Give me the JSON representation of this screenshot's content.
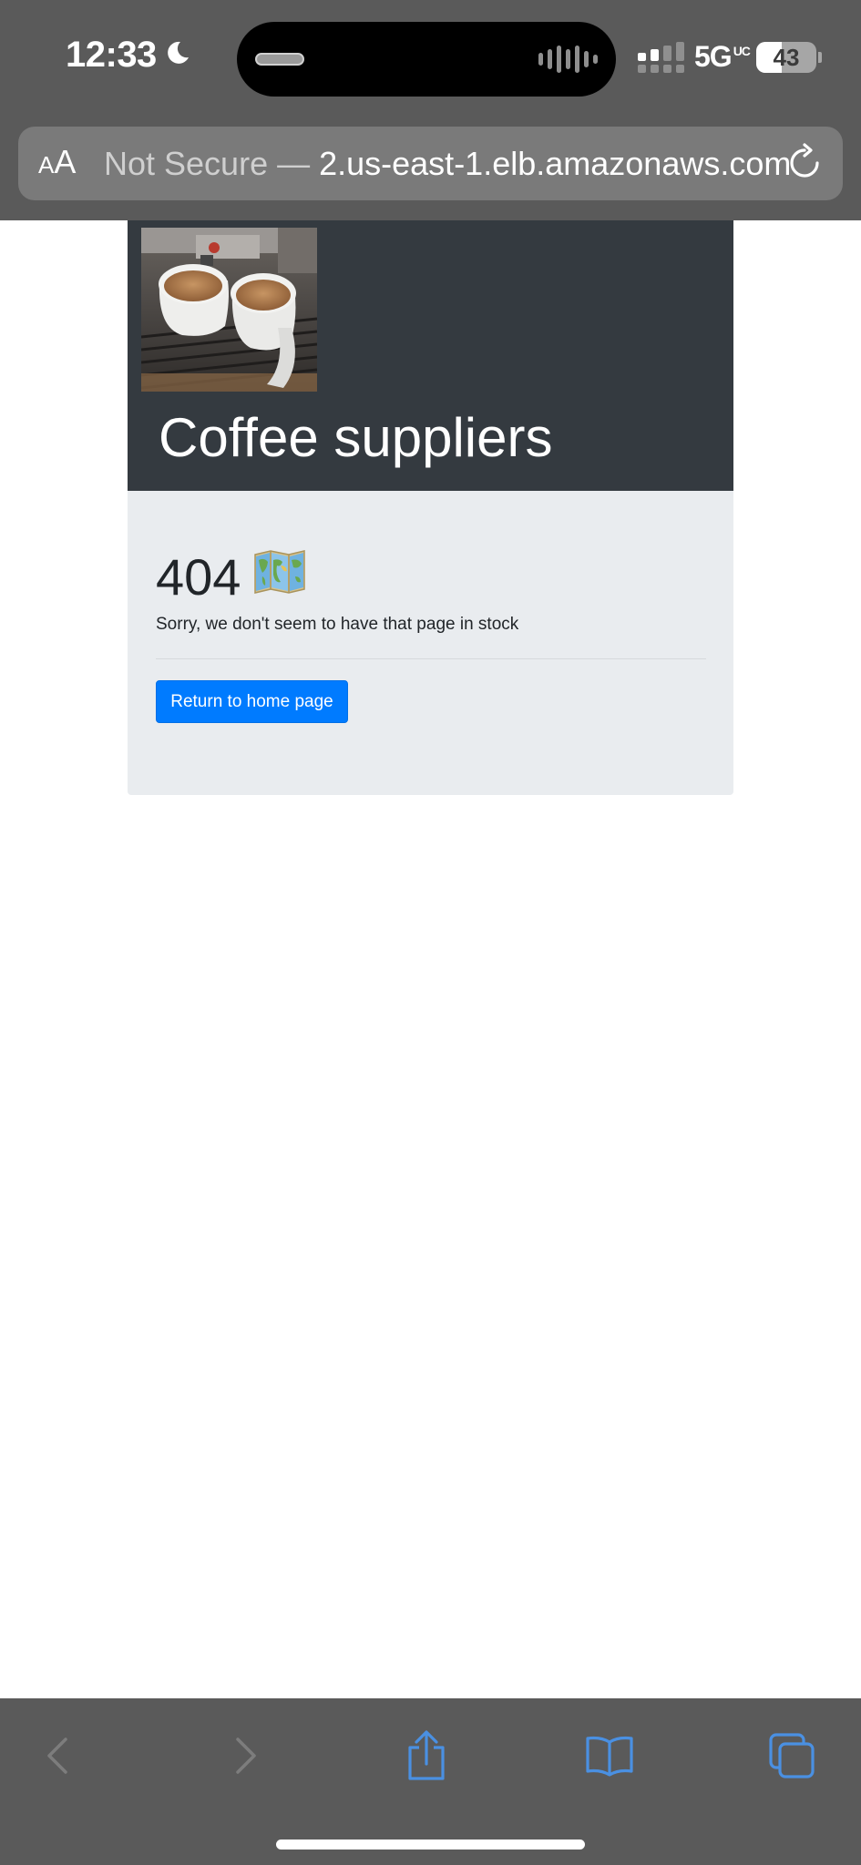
{
  "status_bar": {
    "time": "12:33",
    "network": "5G",
    "network_suffix": "UC",
    "battery_level": "43",
    "battery_fraction": 0.43
  },
  "browser": {
    "text_size_label_small": "A",
    "text_size_label_large": "A",
    "url_security": "Not Secure —",
    "url_host": "2.us-east-1.elb.amazonaws.com"
  },
  "site": {
    "title": "Coffee suppliers",
    "error_code": "404",
    "error_message": "Sorry, we don't seem to have that page in stock",
    "home_button_label": "Return to home page"
  },
  "colors": {
    "chrome_bg": "#5a5a5a",
    "hero_bg": "#343a40",
    "jumbotron_bg": "#e9ecef",
    "primary_button": "#007bff",
    "toolbar_icon": "#4a90e2",
    "toolbar_icon_disabled": "#7d7d7d"
  },
  "icons": {
    "night_mode": "moon-icon",
    "reload": "reload-icon",
    "back": "chevron-left-icon",
    "forward": "chevron-right-icon",
    "share": "share-icon",
    "bookmarks": "book-icon",
    "tabs": "tabs-icon",
    "error_emoji": "world-map-icon"
  }
}
